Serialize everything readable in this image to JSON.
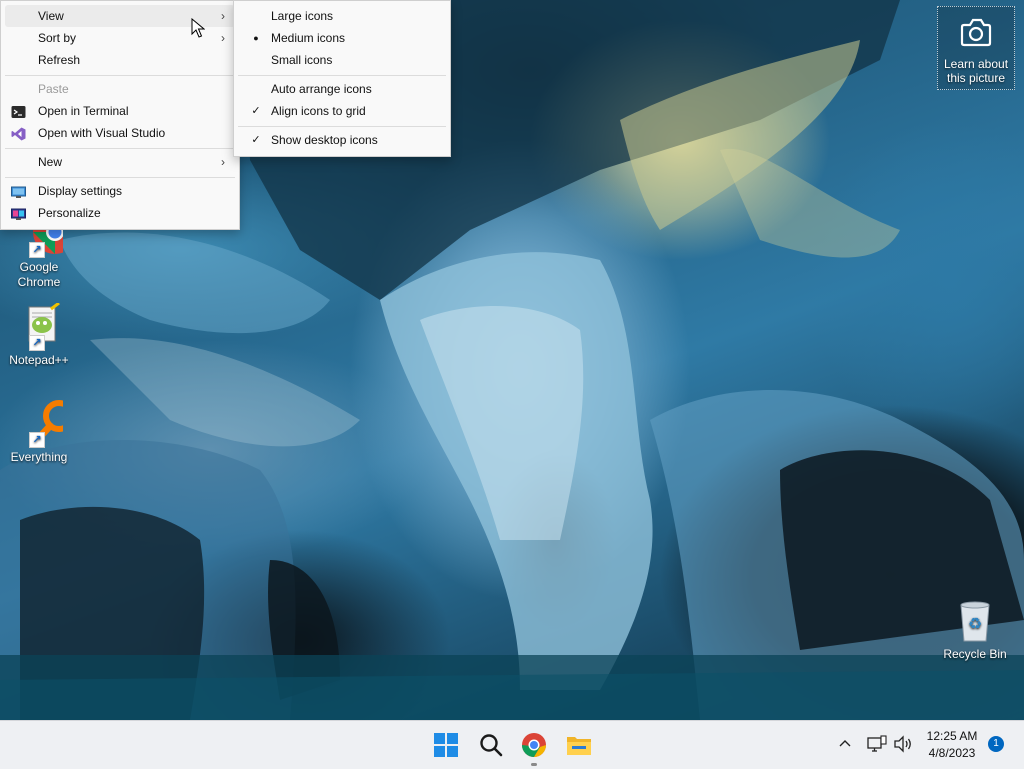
{
  "desktop": {
    "icons": [
      {
        "label": "Google\nChrome",
        "line1": "Google",
        "line2": "Chrome"
      },
      {
        "label": "Notepad++"
      },
      {
        "label": "Everything"
      },
      {
        "label": "Recycle Bin"
      }
    ],
    "camera_widget": {
      "line1": "Learn about",
      "line2": "this picture"
    }
  },
  "context_menu": {
    "items": [
      {
        "label": "View",
        "mnemonic": "V"
      },
      {
        "label": "Sort by"
      },
      {
        "label": "Refresh"
      },
      {
        "label": "Paste",
        "disabled": true
      },
      {
        "label": "Open in Terminal"
      },
      {
        "label": "Open with Visual Studio"
      },
      {
        "label": "New"
      },
      {
        "label": "Display settings"
      },
      {
        "label": "Personalize"
      }
    ]
  },
  "view_submenu": {
    "items": [
      {
        "label": "Large icons"
      },
      {
        "label": "Medium icons",
        "selected": true
      },
      {
        "label": "Small icons"
      },
      {
        "label": "Auto arrange icons"
      },
      {
        "label": "Align icons to grid",
        "checked": true
      },
      {
        "label": "Show desktop icons",
        "checked": true
      }
    ],
    "bullet": "●",
    "check": "✓"
  },
  "taskbar": {
    "time": "12:25 AM",
    "date": "4/8/2023",
    "notification_count": "1",
    "chevron": "^"
  },
  "colors": {
    "accent": "#0067c0",
    "menu_bg": "#f9f9f9",
    "taskbar_bg": "#eef0f3"
  }
}
